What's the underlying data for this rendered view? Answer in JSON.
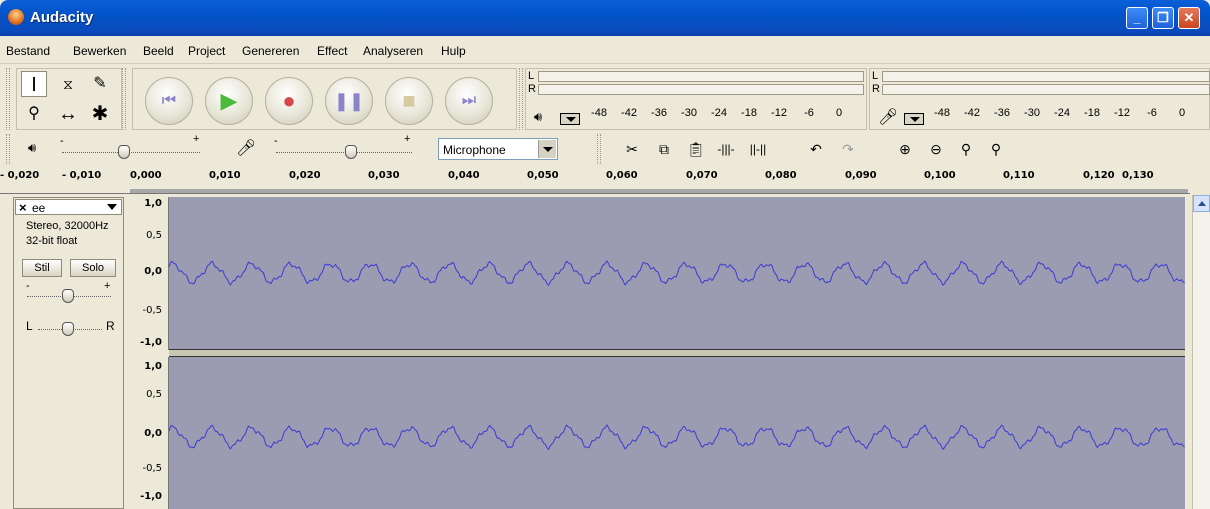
{
  "window": {
    "title": "Audacity"
  },
  "menu": [
    "Bestand",
    "Bewerken",
    "Beeld",
    "Project",
    "Genereren",
    "Effect",
    "Analyseren",
    "Hulp"
  ],
  "meters": {
    "play": {
      "l": "L",
      "r": "R",
      "scale": [
        "-48",
        "-42",
        "-36",
        "-30",
        "-24",
        "-18",
        "-12",
        "-6",
        "0"
      ]
    },
    "rec": {
      "l": "L",
      "r": "R",
      "scale": [
        "-48",
        "-42",
        "-36",
        "-30",
        "-24",
        "-18",
        "-12",
        "-6",
        "0"
      ]
    }
  },
  "mixer": {
    "minus": "-",
    "plus": "+",
    "input_source": "Microphone",
    "play_volume": 0.45,
    "rec_volume": 0.55
  },
  "ruler": [
    "- 0,020",
    "- 0,010",
    "0,000",
    "0,010",
    "0,020",
    "0,030",
    "0,040",
    "0,050",
    "0,060",
    "0,070",
    "0,080",
    "0,090",
    "0,100",
    "0,110",
    "0,120",
    "0,130"
  ],
  "track": {
    "close": "×",
    "name": "ee",
    "format": "Stereo, 32000Hz",
    "sample": "32-bit float",
    "mute": "Stil",
    "solo": "Solo",
    "gain_minus": "-",
    "gain_plus": "+",
    "pan_l": "L",
    "pan_r": "R",
    "channel_scale": [
      "1,0",
      "0,5",
      "0,0",
      "-0,5",
      "-1,0"
    ]
  }
}
